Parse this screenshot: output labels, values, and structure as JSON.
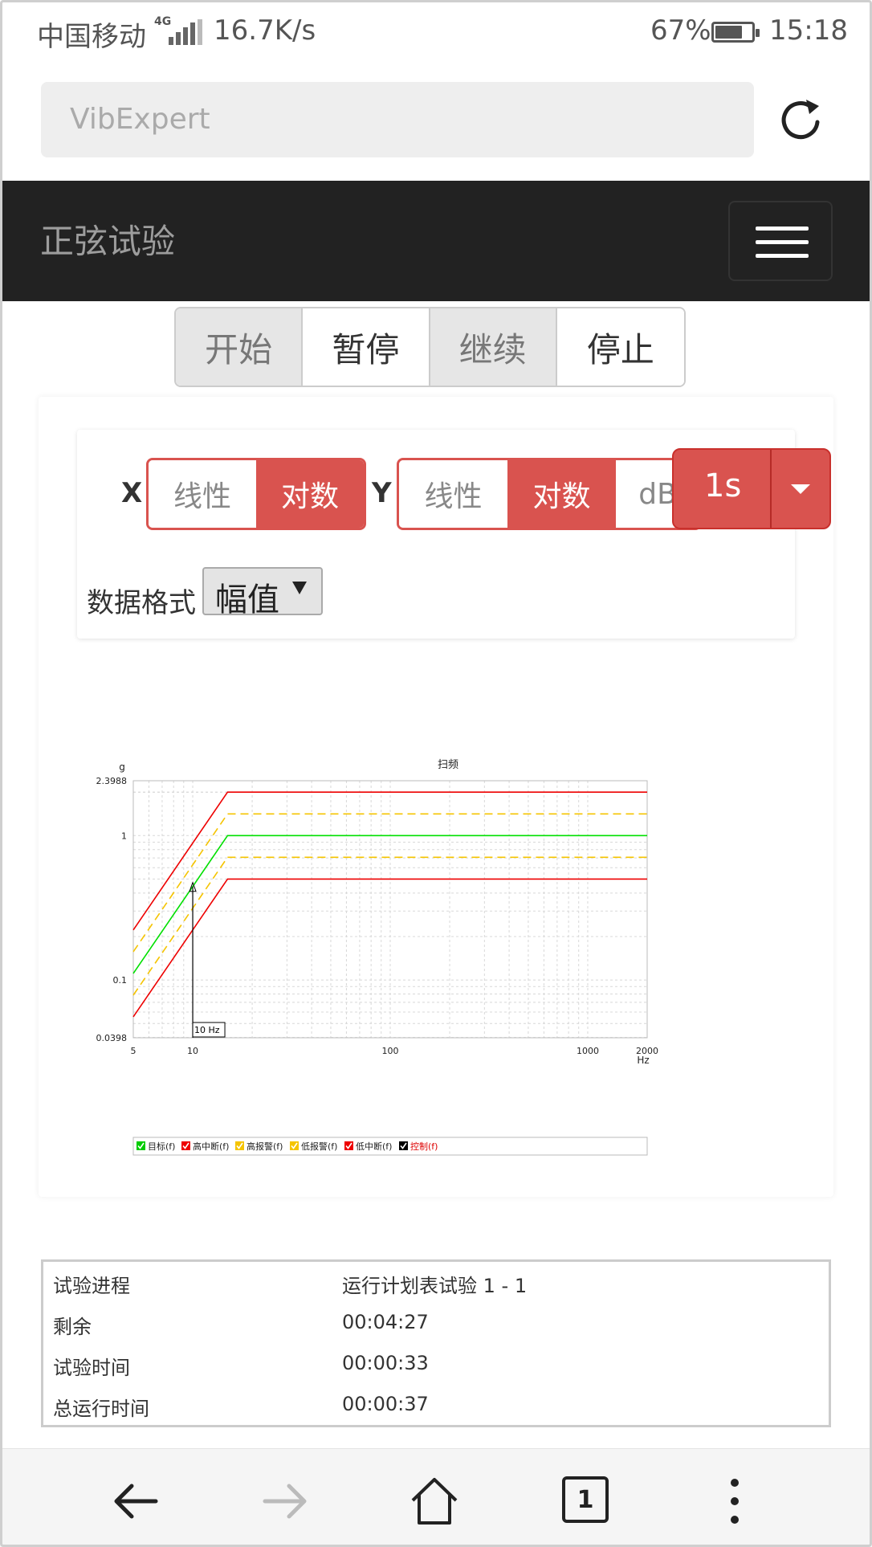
{
  "status_bar": {
    "carrier": "中国移动",
    "network": "4G",
    "speed": "16.7K/s",
    "battery_percent": "67%",
    "battery_level": 0.67,
    "time": "15:18"
  },
  "url_bar": {
    "text": "VibExpert"
  },
  "nav": {
    "title": "正弦试验"
  },
  "controls": [
    "开始",
    "暂停",
    "继续",
    "停止"
  ],
  "axis_options": {
    "x_label": "X",
    "x_buttons": [
      "线性",
      "对数"
    ],
    "y_label": "Y",
    "y_buttons": [
      "线性",
      "对数",
      "dB"
    ],
    "interval": "1s"
  },
  "data_format": {
    "label": "数据格式",
    "value": "幅值"
  },
  "chart": {
    "title": "扫频",
    "y_unit": "g",
    "x_unit": "Hz",
    "y_ticks": [
      "2.3988",
      "1",
      "0.1",
      "0.0398"
    ],
    "x_ticks": [
      "5",
      "10",
      "100",
      "1000",
      "2000"
    ],
    "cursor_label": "10 Hz",
    "legend": [
      "目标(f)",
      "高中断(f)",
      "高报警(f)",
      "低报警(f)",
      "低中断(f)",
      "控制(f)"
    ]
  },
  "chart_data": {
    "type": "line",
    "title": "扫频",
    "xlabel": "Hz",
    "ylabel": "g",
    "xscale": "log",
    "yscale": "log",
    "xlim": [
      5,
      2000
    ],
    "ylim": [
      0.0398,
      2.3988
    ],
    "grid": true,
    "legend_position": "bottom",
    "series": [
      {
        "name": "目标(f)",
        "color": "#00e000",
        "style": "solid",
        "x": [
          5,
          15,
          2000
        ],
        "y": [
          0.111,
          1,
          1
        ]
      },
      {
        "name": "高中断(f)",
        "color": "#ee0000",
        "style": "solid",
        "x": [
          5,
          15,
          2000
        ],
        "y": [
          0.222,
          2,
          2
        ]
      },
      {
        "name": "高报警(f)",
        "color": "#f5c400",
        "style": "dashed",
        "x": [
          5,
          15,
          2000
        ],
        "y": [
          0.157,
          1.413,
          1.413
        ]
      },
      {
        "name": "低报警(f)",
        "color": "#f5c400",
        "style": "dashed",
        "x": [
          5,
          15,
          2000
        ],
        "y": [
          0.0785,
          0.708,
          0.708
        ]
      },
      {
        "name": "低中断(f)",
        "color": "#ee0000",
        "style": "solid",
        "x": [
          5,
          15,
          2000
        ],
        "y": [
          0.0556,
          0.5,
          0.5
        ]
      }
    ],
    "cursor": {
      "x": 10,
      "y": 0.444,
      "label": "10 Hz"
    }
  },
  "info_table": [
    {
      "key": "试验进程",
      "value": "运行计划表试验 1 - 1"
    },
    {
      "key": "剩余",
      "value": "00:04:27"
    },
    {
      "key": "试验时间",
      "value": "00:00:33"
    },
    {
      "key": "总运行时间",
      "value": "00:00:37"
    }
  ],
  "bottom_nav": {
    "tab_count": "1",
    "icons": [
      "back-arrow-icon",
      "forward-arrow-icon",
      "home-icon",
      "tabs-icon",
      "more-icon"
    ]
  }
}
